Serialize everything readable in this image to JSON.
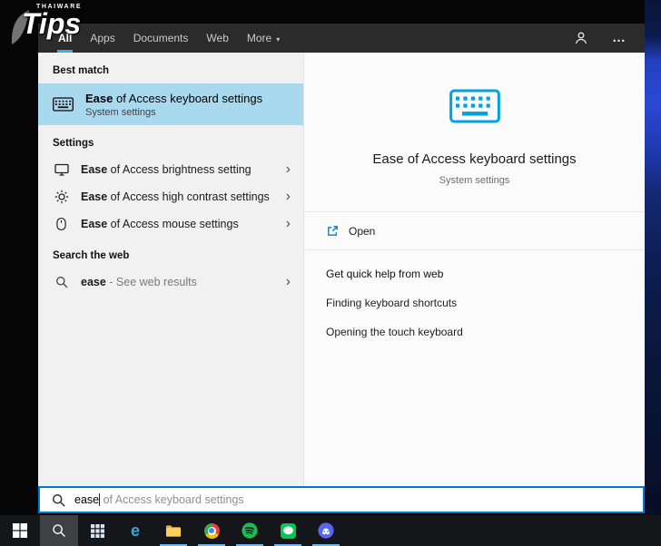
{
  "branding": {
    "logo_main": "Tips",
    "logo_sub": "THAIWARE"
  },
  "icons": {
    "chevron": "›",
    "ellipsis": "…",
    "caret_down": "▾"
  },
  "tabs": {
    "items": [
      {
        "label": "All",
        "active": true
      },
      {
        "label": "Apps",
        "active": false
      },
      {
        "label": "Documents",
        "active": false
      },
      {
        "label": "Web",
        "active": false
      },
      {
        "label": "More",
        "active": false,
        "has_dropdown": true
      }
    ]
  },
  "results": {
    "best_match_header": "Best match",
    "best_match": {
      "query_part": "Ease",
      "rest": " of Access keyboard settings",
      "subtitle": "System settings"
    },
    "settings_header": "Settings",
    "settings_items": [
      {
        "query_part": "Ease",
        "rest": " of Access brightness setting",
        "icon": "display-icon"
      },
      {
        "query_part": "Ease",
        "rest": " of Access high contrast settings",
        "icon": "contrast-icon"
      },
      {
        "query_part": "Ease",
        "rest": " of Access mouse settings",
        "icon": "mouse-icon"
      }
    ],
    "web_header": "Search the web",
    "web_item": {
      "query_part": "ease",
      "rest": " - See web results",
      "icon": "search-icon"
    }
  },
  "preview": {
    "title": "Ease of Access keyboard settings",
    "subtitle": "System settings",
    "open_label": "Open",
    "help_header": "Get quick help from web",
    "help_links": [
      "Finding keyboard shortcuts",
      "Opening the touch keyboard"
    ]
  },
  "search_box": {
    "typed": "ease",
    "suggestion": " of Access keyboard settings"
  },
  "taskbar": {
    "buttons": [
      "start",
      "search",
      "apps-grid",
      "edge",
      "file-explorer",
      "chrome",
      "spotify",
      "line",
      "discord"
    ],
    "running": [
      "file-explorer",
      "chrome",
      "spotify",
      "line",
      "discord"
    ],
    "edge_glyph": "e"
  },
  "colors": {
    "accent": "#0078d7",
    "highlight": "#a9d9ee",
    "cyan": "#00a2e0",
    "tabline": "#3ab0e8",
    "spotify": "#1db954",
    "lineGreen": "#06c755",
    "discord": "#5865f2",
    "folder1": "#e8b33d",
    "folder2": "#ffd05c",
    "edgeBlue": "#36a6e0",
    "chromeRed": "#ea4335",
    "chromeYellow": "#fbbc04",
    "chromeGreen": "#34a853",
    "chromeBlue": "#4285f4"
  }
}
